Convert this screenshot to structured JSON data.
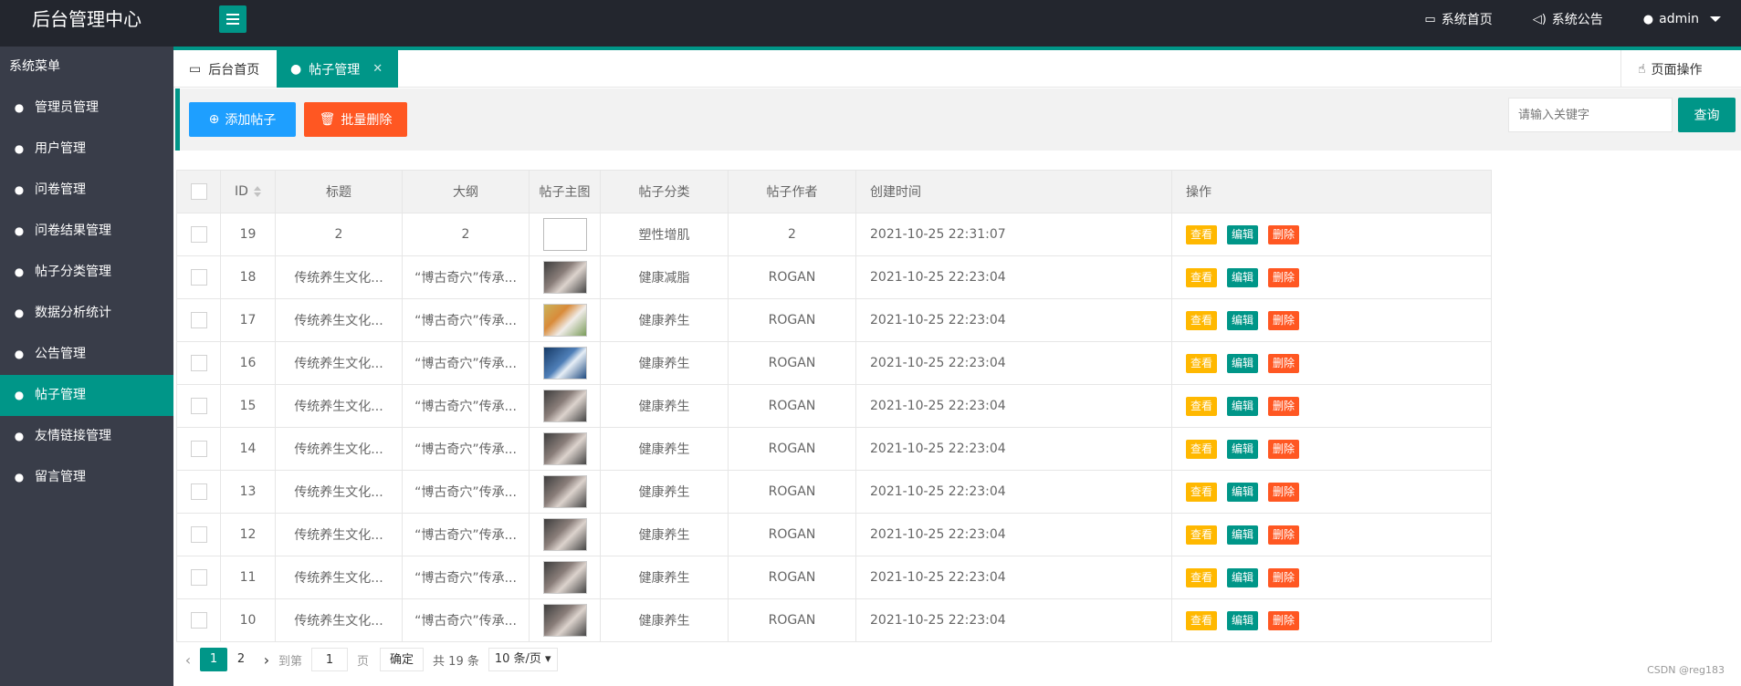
{
  "header": {
    "title": "后台管理中心",
    "links": [
      {
        "label": "系统首页",
        "icon": "monitor-icon"
      },
      {
        "label": "系统公告",
        "icon": "speaker-icon"
      },
      {
        "label": "admin",
        "icon": "user-icon"
      }
    ]
  },
  "sidebar": {
    "title": "系统菜单",
    "items": [
      {
        "label": "管理员管理"
      },
      {
        "label": "用户管理"
      },
      {
        "label": "问卷管理"
      },
      {
        "label": "问卷结果管理"
      },
      {
        "label": "帖子分类管理"
      },
      {
        "label": "数据分析统计"
      },
      {
        "label": "公告管理"
      },
      {
        "label": "帖子管理",
        "active": true
      },
      {
        "label": "友情链接管理"
      },
      {
        "label": "留言管理"
      }
    ]
  },
  "tabs": {
    "home": "后台首页",
    "current": "帖子管理",
    "close": "✕",
    "page_ops": "页面操作"
  },
  "toolbar": {
    "add": "添加帖子",
    "batch_delete": "批量删除",
    "search_placeholder": "请输入关键字",
    "query": "查询"
  },
  "table": {
    "columns": [
      "ID",
      "标题",
      "大纲",
      "帖子主图",
      "帖子分类",
      "帖子作者",
      "创建时间",
      "操作"
    ],
    "actions": {
      "view": "查看",
      "edit": "编辑",
      "delete": "删除"
    },
    "rows": [
      {
        "id": "19",
        "title": "2",
        "outline": "2",
        "image": "broken",
        "category": "塑性增肌",
        "author": "2",
        "created": "2021-10-25 22:31:07"
      },
      {
        "id": "18",
        "title": "传统养生文化...",
        "outline": "“博古奇穴”传承...",
        "image": "t1",
        "category": "健康减脂",
        "author": "ROGAN",
        "created": "2021-10-25 22:23:04"
      },
      {
        "id": "17",
        "title": "传统养生文化...",
        "outline": "“博古奇穴”传承...",
        "image": "t2",
        "category": "健康养生",
        "author": "ROGAN",
        "created": "2021-10-25 22:23:04"
      },
      {
        "id": "16",
        "title": "传统养生文化...",
        "outline": "“博古奇穴”传承...",
        "image": "t3",
        "category": "健康养生",
        "author": "ROGAN",
        "created": "2021-10-25 22:23:04"
      },
      {
        "id": "15",
        "title": "传统养生文化...",
        "outline": "“博古奇穴”传承...",
        "image": "t1",
        "category": "健康养生",
        "author": "ROGAN",
        "created": "2021-10-25 22:23:04"
      },
      {
        "id": "14",
        "title": "传统养生文化...",
        "outline": "“博古奇穴”传承...",
        "image": "t1",
        "category": "健康养生",
        "author": "ROGAN",
        "created": "2021-10-25 22:23:04"
      },
      {
        "id": "13",
        "title": "传统养生文化...",
        "outline": "“博古奇穴”传承...",
        "image": "t1",
        "category": "健康养生",
        "author": "ROGAN",
        "created": "2021-10-25 22:23:04"
      },
      {
        "id": "12",
        "title": "传统养生文化...",
        "outline": "“博古奇穴”传承...",
        "image": "t1",
        "category": "健康养生",
        "author": "ROGAN",
        "created": "2021-10-25 22:23:04"
      },
      {
        "id": "11",
        "title": "传统养生文化...",
        "outline": "“博古奇穴”传承...",
        "image": "t1",
        "category": "健康养生",
        "author": "ROGAN",
        "created": "2021-10-25 22:23:04"
      },
      {
        "id": "10",
        "title": "传统养生文化...",
        "outline": "“博古奇穴”传承...",
        "image": "t1",
        "category": "健康养生",
        "author": "ROGAN",
        "created": "2021-10-25 22:23:04"
      }
    ]
  },
  "pagination": {
    "pages": [
      "1",
      "2"
    ],
    "current": "1",
    "goto_label": "到第",
    "goto_value": "1",
    "page_unit": "页",
    "confirm": "确定",
    "total": "共 19 条",
    "per_page": "10 条/页"
  },
  "watermark": "CSDN @reg183"
}
